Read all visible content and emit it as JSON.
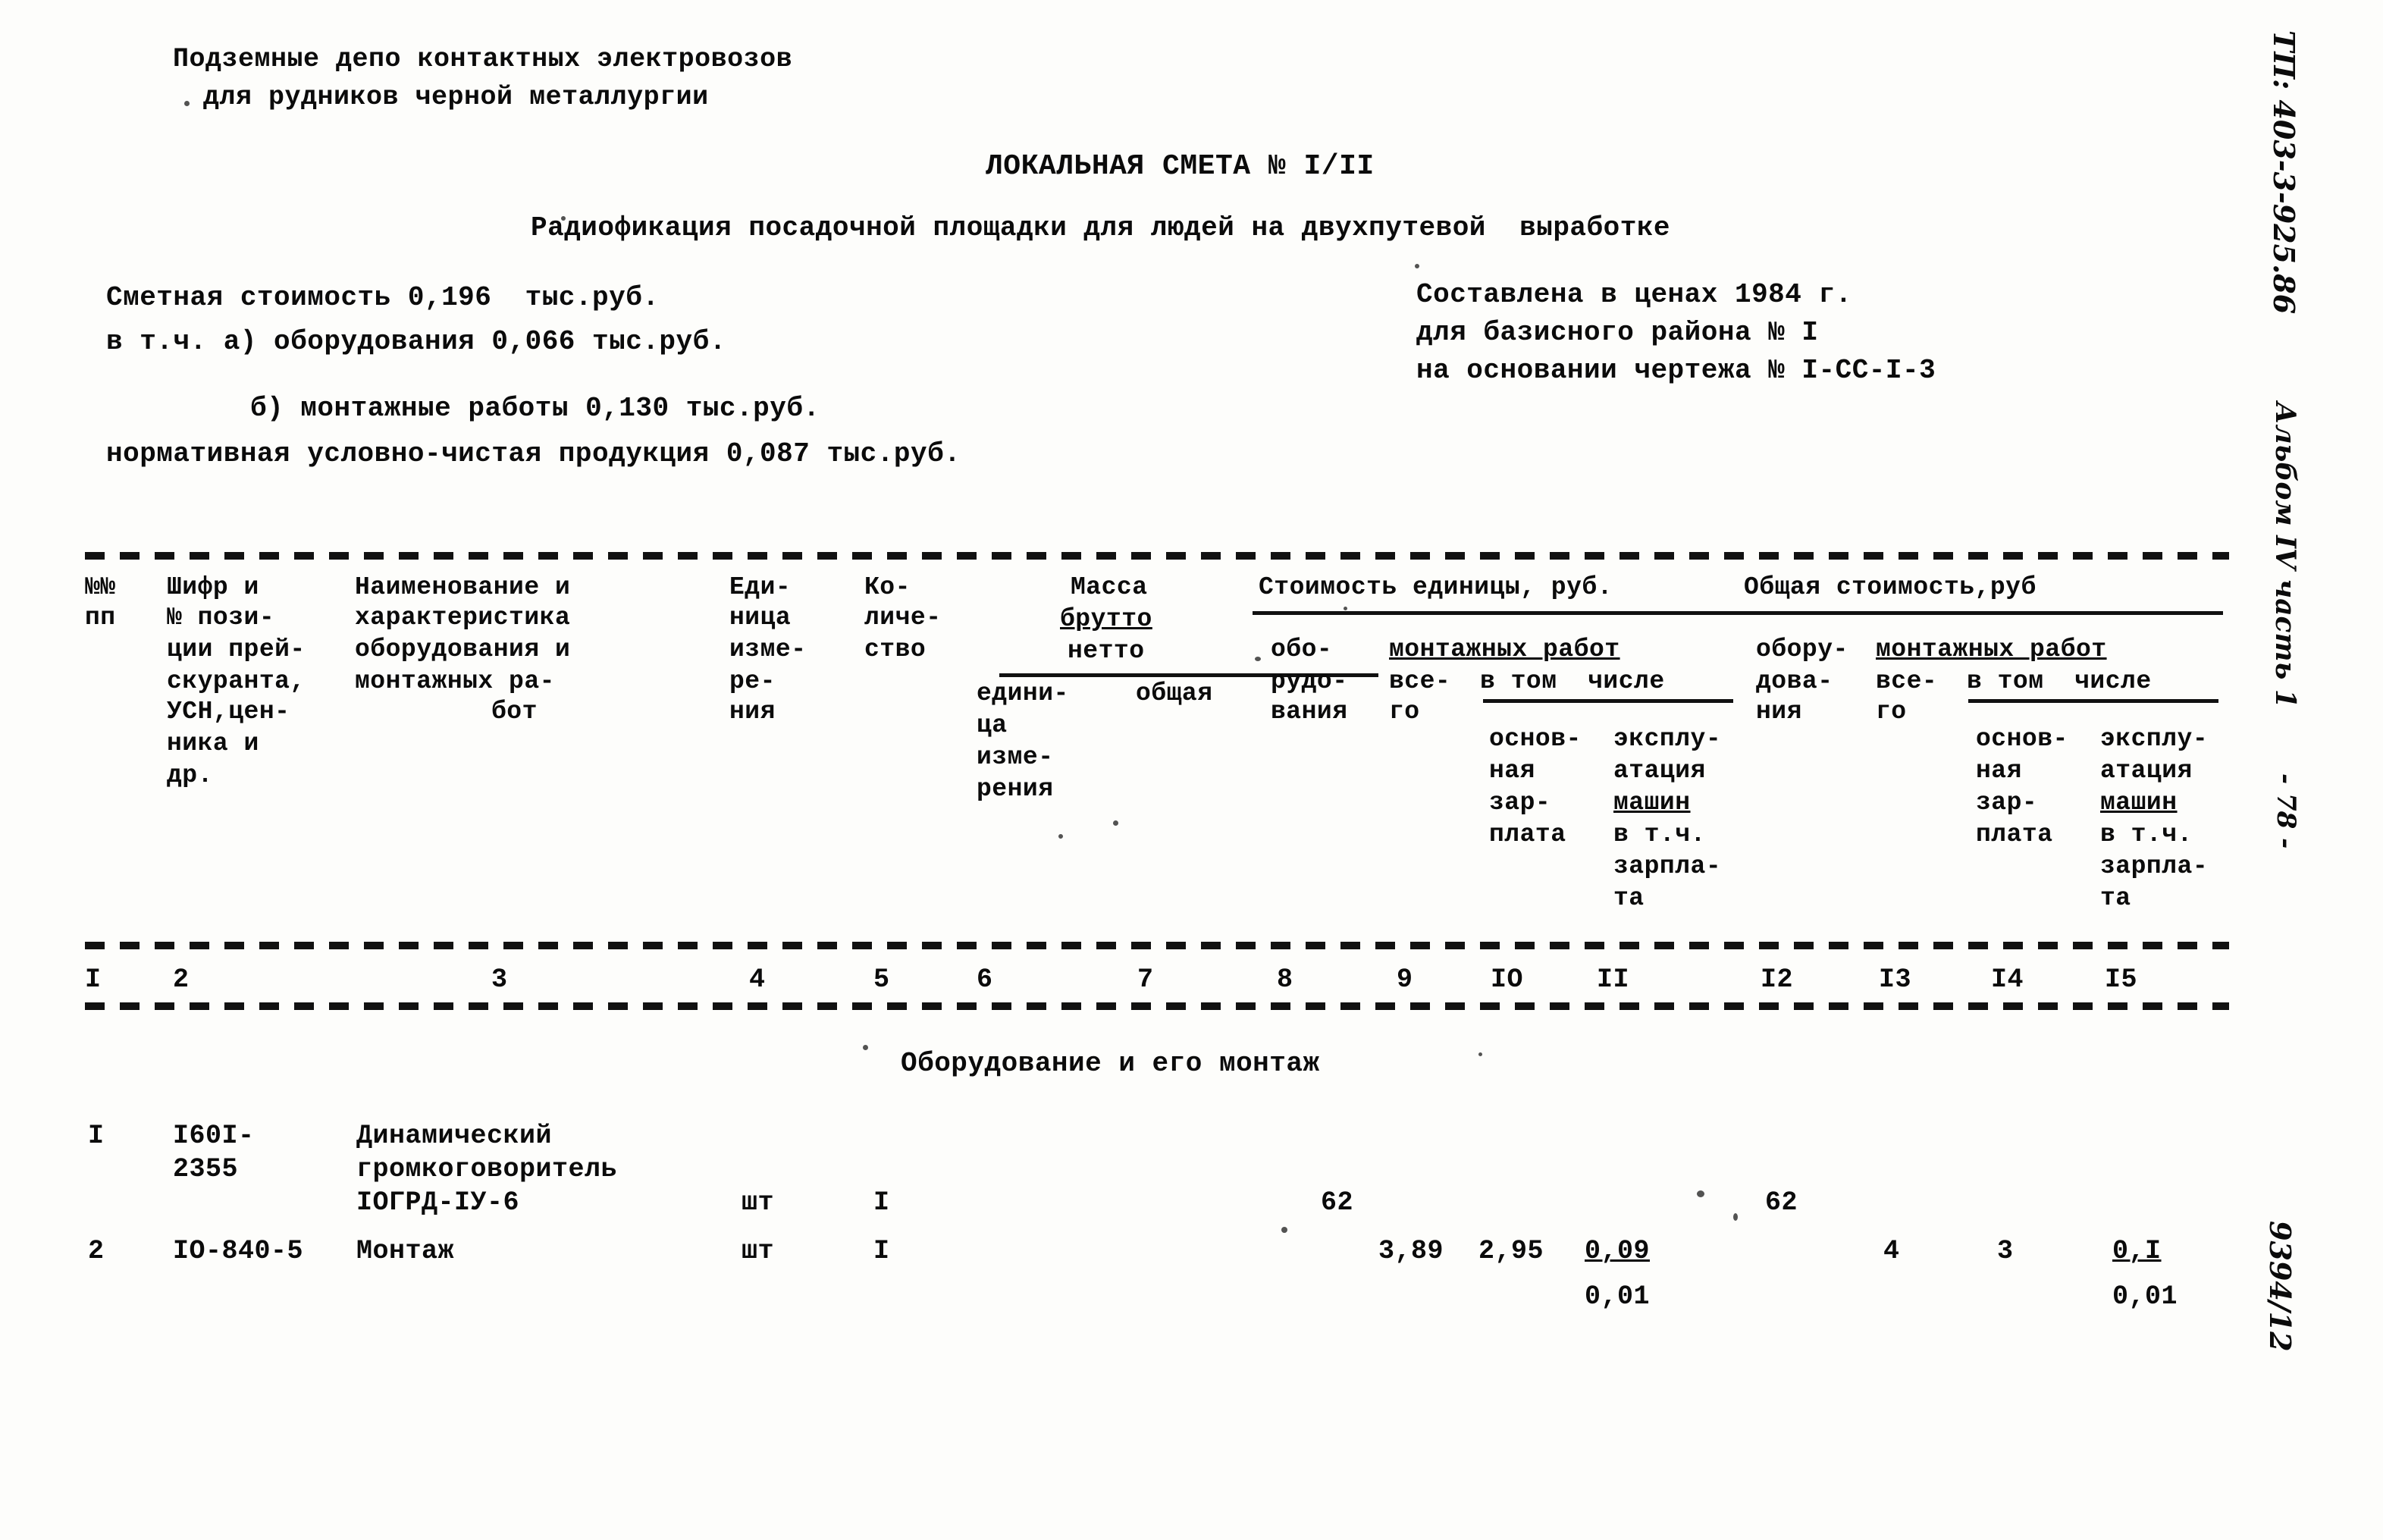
{
  "header": {
    "line1": "Подземные депо контактных электровозов",
    "line2": "для рудников черной металлургии"
  },
  "title": {
    "main": "ЛОКАЛЬНАЯ СМЕТА № I/II",
    "subtitle": "Радиофикация посадочной площадки для людей на двухпутевой  выработке"
  },
  "summary": {
    "left": [
      "Сметная стоимость 0,196  тыс.руб.",
      "в т.ч. а) оборудования 0,066 тыс.руб.",
      "б) монтажные работы 0,130 тыс.руб.",
      "нормативная условно-чистая продукция 0,087 тыс.руб."
    ],
    "right": [
      "Составлена в ценах 1984 г.",
      "для базисного района № I",
      "на основании чертежа № I-СС-I-3"
    ]
  },
  "table": {
    "headers": {
      "col1": [
        "№№",
        "пп"
      ],
      "col2": [
        "Шифр и",
        "№ пози-",
        "ции прей-",
        "скуранта,",
        "УСН,цен-",
        "ника и",
        "др."
      ],
      "col3": [
        "Наименование и",
        "характеристика",
        "оборудования и",
        "монтажных ра-",
        "бот"
      ],
      "col4": [
        "Еди-",
        "ница",
        "изме-",
        "ре-",
        "ния"
      ],
      "col5": [
        "Ко-",
        "личе-",
        "ство"
      ],
      "mass_group": {
        "title": "Масса",
        "brutto": "брутто",
        "netto": "нетто",
        "col6": [
          "едини-",
          "ца",
          "изме-",
          "рения"
        ],
        "col7": [
          "общая"
        ]
      },
      "unit_cost_group": {
        "title": "Стоимость единицы, руб.",
        "col8": [
          "обо-",
          "рудо-",
          "вания"
        ],
        "montazh_label": "монтажных работ",
        "col9": [
          "все-",
          "го"
        ],
        "vtch_label": "в том  числе",
        "col10": [
          "основ-",
          "ная",
          "зар-",
          "плата"
        ],
        "col11": [
          "эксплу-",
          "атация",
          "машин",
          "в т.ч.",
          "зарпла-",
          "та"
        ]
      },
      "total_cost_group": {
        "title": "Общая стоимость,руб",
        "col12": [
          "обору-",
          "дова-",
          "ния"
        ],
        "montazh_label": "монтажных работ",
        "col13": [
          "все-",
          "го"
        ],
        "vtch_label": "в том  числе",
        "col14": [
          "основ-",
          "ная",
          "зар-",
          "плата"
        ],
        "col15": [
          "эксплу-",
          "атация",
          "машин",
          "в т.ч.",
          "зарпла-",
          "та"
        ]
      }
    },
    "column_numbers": [
      "I",
      "2",
      "3",
      "4",
      "5",
      "6",
      "7",
      "8",
      "9",
      "IO",
      "II",
      "I2",
      "I3",
      "I4",
      "I5"
    ],
    "section_title": "Оборудование и его монтаж",
    "rows": [
      {
        "num": "I",
        "code": [
          "I60I-",
          "2355"
        ],
        "name": [
          "Динамический",
          "громкоговоритель",
          "IОГРД-IУ-6"
        ],
        "unit": "шт",
        "qty": "I",
        "mass_unit": "",
        "mass_total": "",
        "equip_unit": "62",
        "mont_total": "",
        "mont_zp": "",
        "mont_mach_top": "",
        "mont_mach_bot": "",
        "equip_sum": "62",
        "mont_sum_total": "",
        "mont_sum_zp": "",
        "mont_sum_mach_top": "",
        "mont_sum_mach_bot": ""
      },
      {
        "num": "2",
        "code": [
          "IO-840-5"
        ],
        "name": [
          "Монтаж"
        ],
        "unit": "шт",
        "qty": "I",
        "mass_unit": "",
        "mass_total": "",
        "equip_unit": "",
        "mont_total": "3,89",
        "mont_zp": "2,95",
        "mont_mach_top": "0,09",
        "mont_mach_bot": "0,01",
        "equip_sum": "",
        "mont_sum_total": "4",
        "mont_sum_zp": "3",
        "mont_sum_mach_top": "0,I",
        "mont_sum_mach_bot": "0,01"
      }
    ]
  },
  "margin": {
    "project_code": "ТП: 403-3-925.86",
    "album": "Альбом IV часть 1",
    "page_number": "- 78 -",
    "doc_number": "9394/12"
  }
}
